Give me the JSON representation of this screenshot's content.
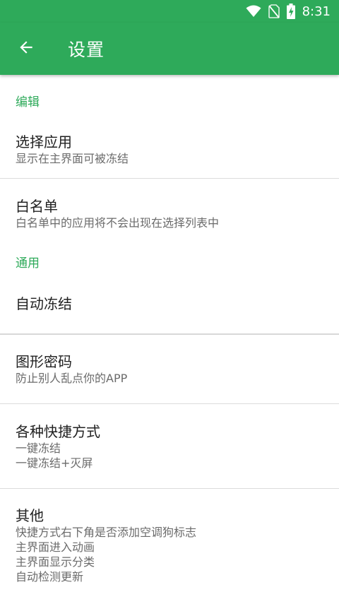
{
  "status_bar": {
    "time": "8:31",
    "icons": [
      "wifi-icon",
      "no-sim-icon",
      "battery-charging-icon"
    ]
  },
  "app_bar": {
    "back_icon": "arrow-left-icon",
    "title": "设置"
  },
  "sections": {
    "edit": {
      "header": "编辑",
      "select_apps": {
        "title": "选择应用",
        "subtitle": "显示在主界面可被冻结"
      },
      "whitelist": {
        "title": "白名单",
        "subtitle": "白名单中的应用将不会出现在选择列表中"
      }
    },
    "general": {
      "header": "通用",
      "auto_freeze": {
        "title": "自动冻结"
      },
      "pattern_password": {
        "title": "图形密码",
        "subtitle": "防止别人乱点你的APP"
      },
      "shortcuts": {
        "title": "各种快捷方式",
        "lines": [
          "一键冻结",
          "一键冻结+灭屏"
        ]
      },
      "other": {
        "title": "其他",
        "lines": [
          "快捷方式右下角是否添加空调狗标志",
          "主界面进入动画",
          "主界面显示分类",
          "自动检测更新"
        ]
      }
    }
  },
  "colors": {
    "primary": "#2eaa5a",
    "section_header": "#2eaa5a",
    "title_text": "#212121",
    "subtitle_text": "#6b6b6b",
    "divider": "#dcdcdc"
  }
}
